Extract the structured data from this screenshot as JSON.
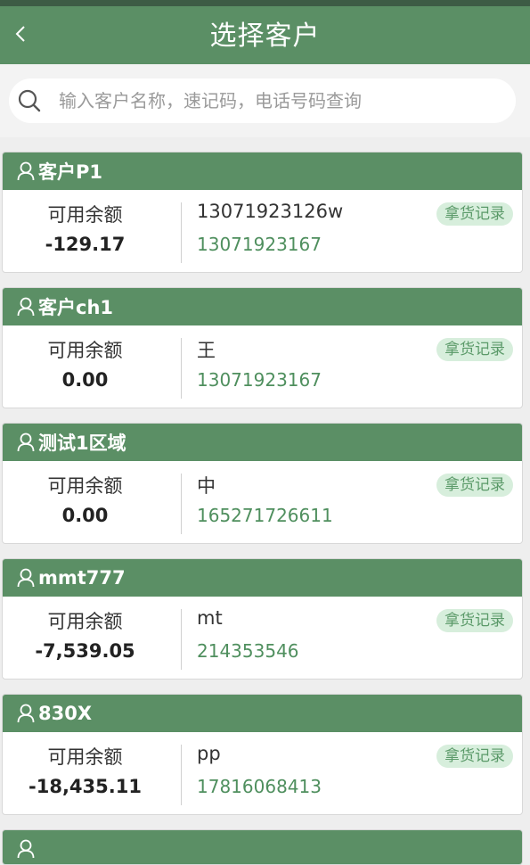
{
  "header": {
    "title": "选择客户"
  },
  "search": {
    "placeholder": "输入客户名称，速记码，电话号码查询"
  },
  "customers": [
    {
      "name": "客户P1",
      "balance_label": "可用余额",
      "balance": "-129.17",
      "contact": "13071923126w",
      "phone": "13071923167",
      "tag": "拿货记录"
    },
    {
      "name": "客户ch1",
      "balance_label": "可用余额",
      "balance": "0.00",
      "contact": "王",
      "phone": "13071923167",
      "tag": "拿货记录"
    },
    {
      "name": "测试1区域",
      "balance_label": "可用余额",
      "balance": "0.00",
      "contact": "中",
      "phone": "165271726611",
      "tag": "拿货记录"
    },
    {
      "name": "mmt777",
      "balance_label": "可用余额",
      "balance": "-7,539.05",
      "contact": "mt",
      "phone": "214353546",
      "tag": "拿货记录"
    },
    {
      "name": "830X",
      "balance_label": "可用余额",
      "balance": "-18,435.11",
      "contact": "pp",
      "phone": "17816068413",
      "tag": "拿货记录"
    }
  ],
  "icons": {
    "back": "chevron-left-icon",
    "search": "search-icon",
    "user": "user-icon"
  },
  "colors": {
    "brand_green": "#5b8f65",
    "phone_green": "#4f8f5e",
    "tag_bg": "#d7eedc"
  }
}
